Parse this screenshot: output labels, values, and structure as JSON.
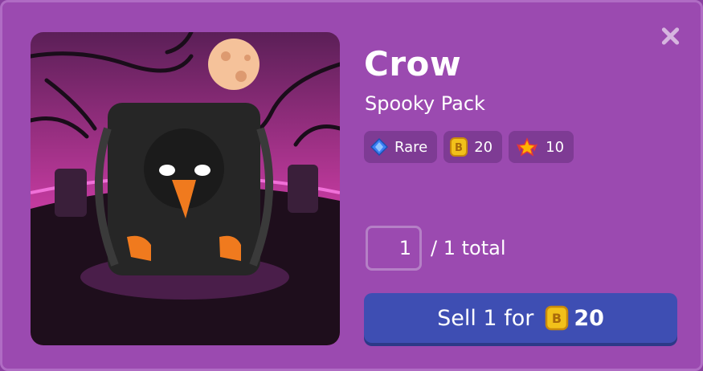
{
  "item": {
    "name": "Crow",
    "pack": "Spooky Pack"
  },
  "badges": {
    "rarity": "Rare",
    "coin_value": "20",
    "xp_value": "10"
  },
  "quantity": {
    "value": "1",
    "total_label": "/ 1 total"
  },
  "sell_button": {
    "label": "Sell 1 for",
    "amount": "20"
  },
  "icons": [
    "close-icon",
    "rare-gem-icon",
    "coin-icon",
    "xp-star-icon"
  ],
  "colors": {
    "panel": "#9b4ab0",
    "sell_button": "#3e4eb3",
    "coin": "#f2c11a"
  }
}
